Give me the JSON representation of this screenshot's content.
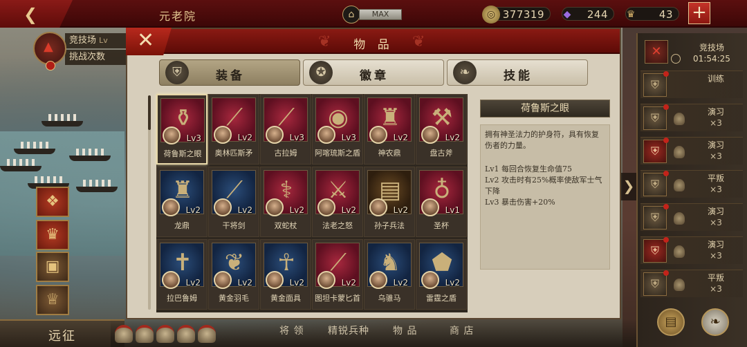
{
  "topbar": {
    "back_icon": "back-arrow-icon",
    "title": "元老院",
    "capacity_icon": "temple-icon",
    "capacity_label": "MAX",
    "gold": "377319",
    "gems": "244",
    "soldiers": "43",
    "plus_icon": "plus-icon"
  },
  "left_panel": {
    "arena_label": "竞技场",
    "arena_level_prefix": "Lv",
    "challenge_label": "挑战次数",
    "expedition_label": "远征"
  },
  "bottom_bar": {
    "tabs": [
      "将 领",
      "精锐兵种",
      "物 品",
      "商 店"
    ]
  },
  "dialog": {
    "title": "物 品",
    "close_icon": "close-x-icon",
    "tabs": [
      {
        "label": "装备",
        "icon": "helmet-icon",
        "active": true
      },
      {
        "label": "徽章",
        "icon": "badge-icon",
        "active": false
      },
      {
        "label": "技能",
        "icon": "scroll-icon",
        "active": false
      }
    ],
    "items": [
      {
        "name": "荷鲁斯之眼",
        "level": "Lv3",
        "bg": "red",
        "glyph": "⚱",
        "selected": true
      },
      {
        "name": "奥林匹斯矛",
        "level": "Lv2",
        "bg": "red",
        "glyph": "⟋"
      },
      {
        "name": "古拉姆",
        "level": "Lv3",
        "bg": "red",
        "glyph": "⟋"
      },
      {
        "name": "阿喀琉斯之盾",
        "level": "Lv3",
        "bg": "red",
        "glyph": "◉"
      },
      {
        "name": "神农鼎",
        "level": "Lv2",
        "bg": "red",
        "glyph": "♜"
      },
      {
        "name": "盘古斧",
        "level": "Lv2",
        "bg": "red",
        "glyph": "⚒"
      },
      {
        "name": "龙鼎",
        "level": "Lv2",
        "bg": "blue",
        "glyph": "♜"
      },
      {
        "name": "干将剑",
        "level": "Lv2",
        "bg": "blue",
        "glyph": "⟋"
      },
      {
        "name": "双蛇杖",
        "level": "Lv2",
        "bg": "red",
        "glyph": "⚕"
      },
      {
        "name": "法老之怒",
        "level": "Lv2",
        "bg": "red",
        "glyph": "⚔"
      },
      {
        "name": "孙子兵法",
        "level": "Lv2",
        "bg": "gold",
        "glyph": "▤"
      },
      {
        "name": "圣杯",
        "level": "Lv1",
        "bg": "red",
        "glyph": "♁"
      },
      {
        "name": "拉巴鲁姆",
        "level": "Lv2",
        "bg": "blue",
        "glyph": "✝"
      },
      {
        "name": "黄金羽毛",
        "level": "Lv2",
        "bg": "blue",
        "glyph": "❦"
      },
      {
        "name": "黄金面具",
        "level": "Lv2",
        "bg": "blue",
        "glyph": "☥"
      },
      {
        "name": "图坦卡蒙匕首",
        "level": "Lv2",
        "bg": "red",
        "glyph": "⟋"
      },
      {
        "name": "乌骓马",
        "level": "Lv2",
        "bg": "blue",
        "glyph": "♞"
      },
      {
        "name": "雷霆之盾",
        "level": "Lv2",
        "bg": "blue",
        "glyph": "⬟"
      }
    ],
    "detail": {
      "title": "荷鲁斯之眼",
      "description": "拥有神圣法力的护身符，具有恢复伤者的力量。",
      "levels": [
        "Lv1  每回合恢复生命值75",
        "Lv2  攻击时有25%概率使敌军士气下降",
        "Lv3  暴击伤害+20%"
      ]
    }
  },
  "right_panel": {
    "arena_label": "竞技场",
    "arena_time": "01:54:25",
    "rows": [
      {
        "name": "训练",
        "sub": "",
        "red": false
      },
      {
        "name": "演习",
        "sub": "×3",
        "red": false
      },
      {
        "name": "演习",
        "sub": "×3",
        "red": true
      },
      {
        "name": "平叛",
        "sub": "×3",
        "red": false
      },
      {
        "name": "演习",
        "sub": "×3",
        "red": false
      },
      {
        "name": "演习",
        "sub": "×3",
        "red": true
      },
      {
        "name": "平叛",
        "sub": "×3",
        "red": false
      }
    ]
  }
}
